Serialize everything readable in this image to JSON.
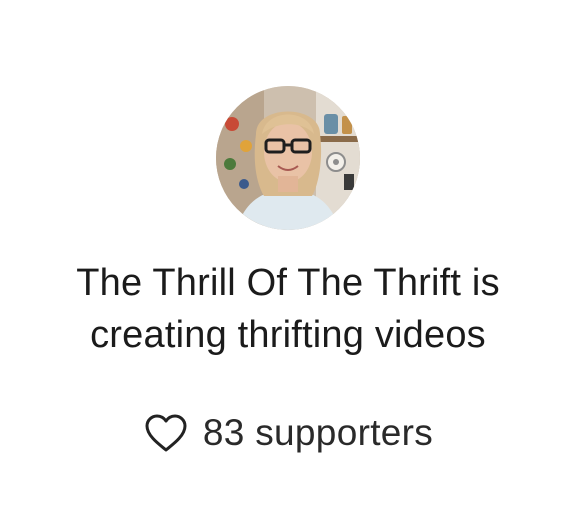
{
  "creator": {
    "name_line": "The Thrill Of The Thrift is",
    "activity_line": "creating thrifting videos",
    "avatar_icon": "avatar-photo"
  },
  "stats": {
    "supporters_text": "83 supporters",
    "icon": "heart-icon"
  },
  "colors": {
    "text": "#1b1b1b",
    "background": "#ffffff"
  }
}
